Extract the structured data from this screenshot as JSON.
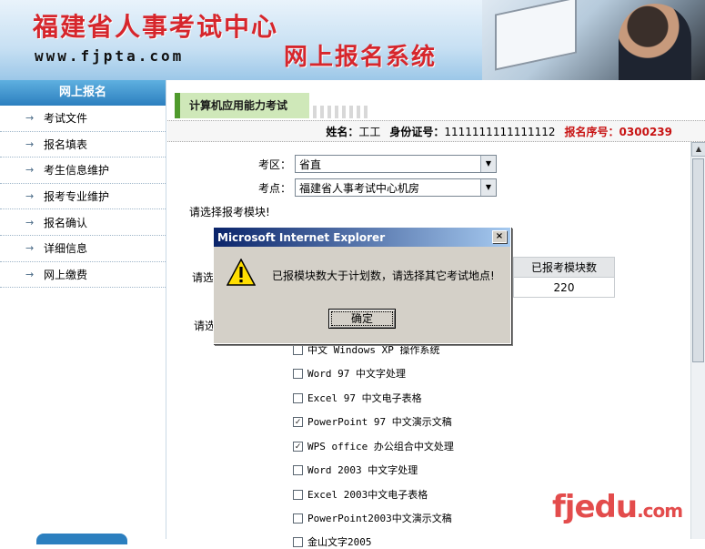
{
  "banner": {
    "title": "福建省人事考试中心",
    "url": "www.fjpta.com",
    "subtitle": "网上报名系统"
  },
  "sidebar": {
    "header": "网上报名",
    "items": [
      {
        "label": "考试文件"
      },
      {
        "label": "报名填表"
      },
      {
        "label": "考生信息维护"
      },
      {
        "label": "报考专业维护"
      },
      {
        "label": "报名确认"
      },
      {
        "label": "详细信息"
      },
      {
        "label": "网上缴费"
      }
    ]
  },
  "main": {
    "tab_label": "计算机应用能力考试",
    "info": {
      "name_label": "姓名：",
      "name_value": "工工",
      "id_label": "身份证号：",
      "id_value": "1111111111111112",
      "reg_label": "报名序号：",
      "reg_value": "0300239"
    },
    "exam_area_label": "考区：",
    "exam_area_value": "省直",
    "exam_site_label": "考点：",
    "exam_site_value": "福建省人事考试中心机房",
    "prompt_module": "请选择报考模块!",
    "prompt_left_a": "请选",
    "prompt_left_b": "请选",
    "table": {
      "header": "已报考模块数",
      "value": "220"
    },
    "modules": [
      {
        "label": "中文 Windows XP 操作系统",
        "checked": false
      },
      {
        "label": "Word 97 中文字处理",
        "checked": false
      },
      {
        "label": "Excel 97 中文电子表格",
        "checked": false
      },
      {
        "label": "PowerPoint 97 中文演示文稿",
        "checked": true
      },
      {
        "label": "WPS office 办公组合中文处理",
        "checked": true
      },
      {
        "label": "Word 2003 中文字处理",
        "checked": false
      },
      {
        "label": "Excel 2003中文电子表格",
        "checked": false
      },
      {
        "label": "PowerPoint2003中文演示文稿",
        "checked": false
      },
      {
        "label": "金山文字2005",
        "checked": false
      }
    ]
  },
  "dialog": {
    "title": "Microsoft Internet Explorer",
    "message": "已报模块数大于计划数，请选择其它考试地点!",
    "ok_label": "确定",
    "close_glyph": "×"
  },
  "watermark": {
    "text": "fjedu",
    "suffix": ".com"
  },
  "colors": {
    "accent_red": "#d6262c",
    "sidebar_blue": "#2c7fbf",
    "tab_green": "#cfe8b9"
  }
}
